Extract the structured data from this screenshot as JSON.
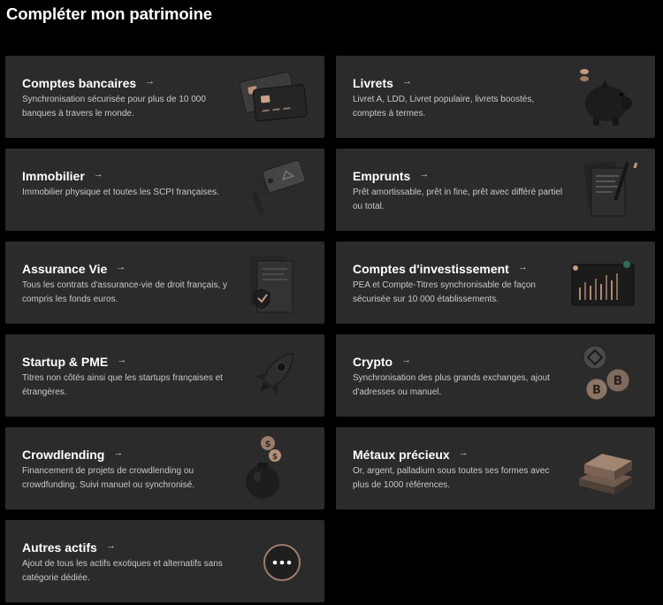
{
  "page": {
    "title": "Compléter mon patrimoine"
  },
  "arrow": "→",
  "accent_color": "#e8c2a6",
  "card_color": "#2b2b2b",
  "cards": [
    {
      "title": "Comptes bancaires",
      "desc": "Synchronisation sécurisée pour plus de 10 000 banques à travers le monde.",
      "icon": "bank-cards-icon"
    },
    {
      "title": "Livrets",
      "desc": "Livret A, LDD, Livret populaire, livrets boostés, comptes à termes.",
      "icon": "piggy-bank-icon"
    },
    {
      "title": "Immobilier",
      "desc": "Immobilier physique et toutes les SCPI françaises.",
      "icon": "house-key-icon"
    },
    {
      "title": "Emprunts",
      "desc": "Prêt amortissable, prêt in fine, prêt avec différé partiel ou total.",
      "icon": "loan-document-icon"
    },
    {
      "title": "Assurance Vie",
      "desc": "Tous les contrats d'assurance-vie de droit français, y compris les fonds euros.",
      "icon": "insurance-contract-icon"
    },
    {
      "title": "Comptes d'investissement",
      "desc": "PEA et Compte-Titres synchronisable de façon sécurisée sur 10 000 établissements.",
      "icon": "stock-chart-icon"
    },
    {
      "title": "Startup & PME",
      "desc": "Titres non côtés ainsi que les startups françaises et étrangères.",
      "icon": "rocket-icon"
    },
    {
      "title": "Crypto",
      "desc": "Synchronisation des plus grands exchanges, ajout d'adresses ou manuel.",
      "icon": "crypto-coins-icon"
    },
    {
      "title": "Crowdlending",
      "desc": "Financement de projets de crowdlending ou crowdfunding. Suivi manuel ou synchronisé.",
      "icon": "money-bag-icon"
    },
    {
      "title": "Métaux précieux",
      "desc": "Or, argent, palladium sous toutes ses formes avec plus de 1000 références.",
      "icon": "gold-bars-icon"
    },
    {
      "title": "Autres actifs",
      "desc": "Ajout de tous les actifs exotiques et alternatifs sans catégorie dédiée.",
      "icon": "more-options-icon"
    }
  ]
}
